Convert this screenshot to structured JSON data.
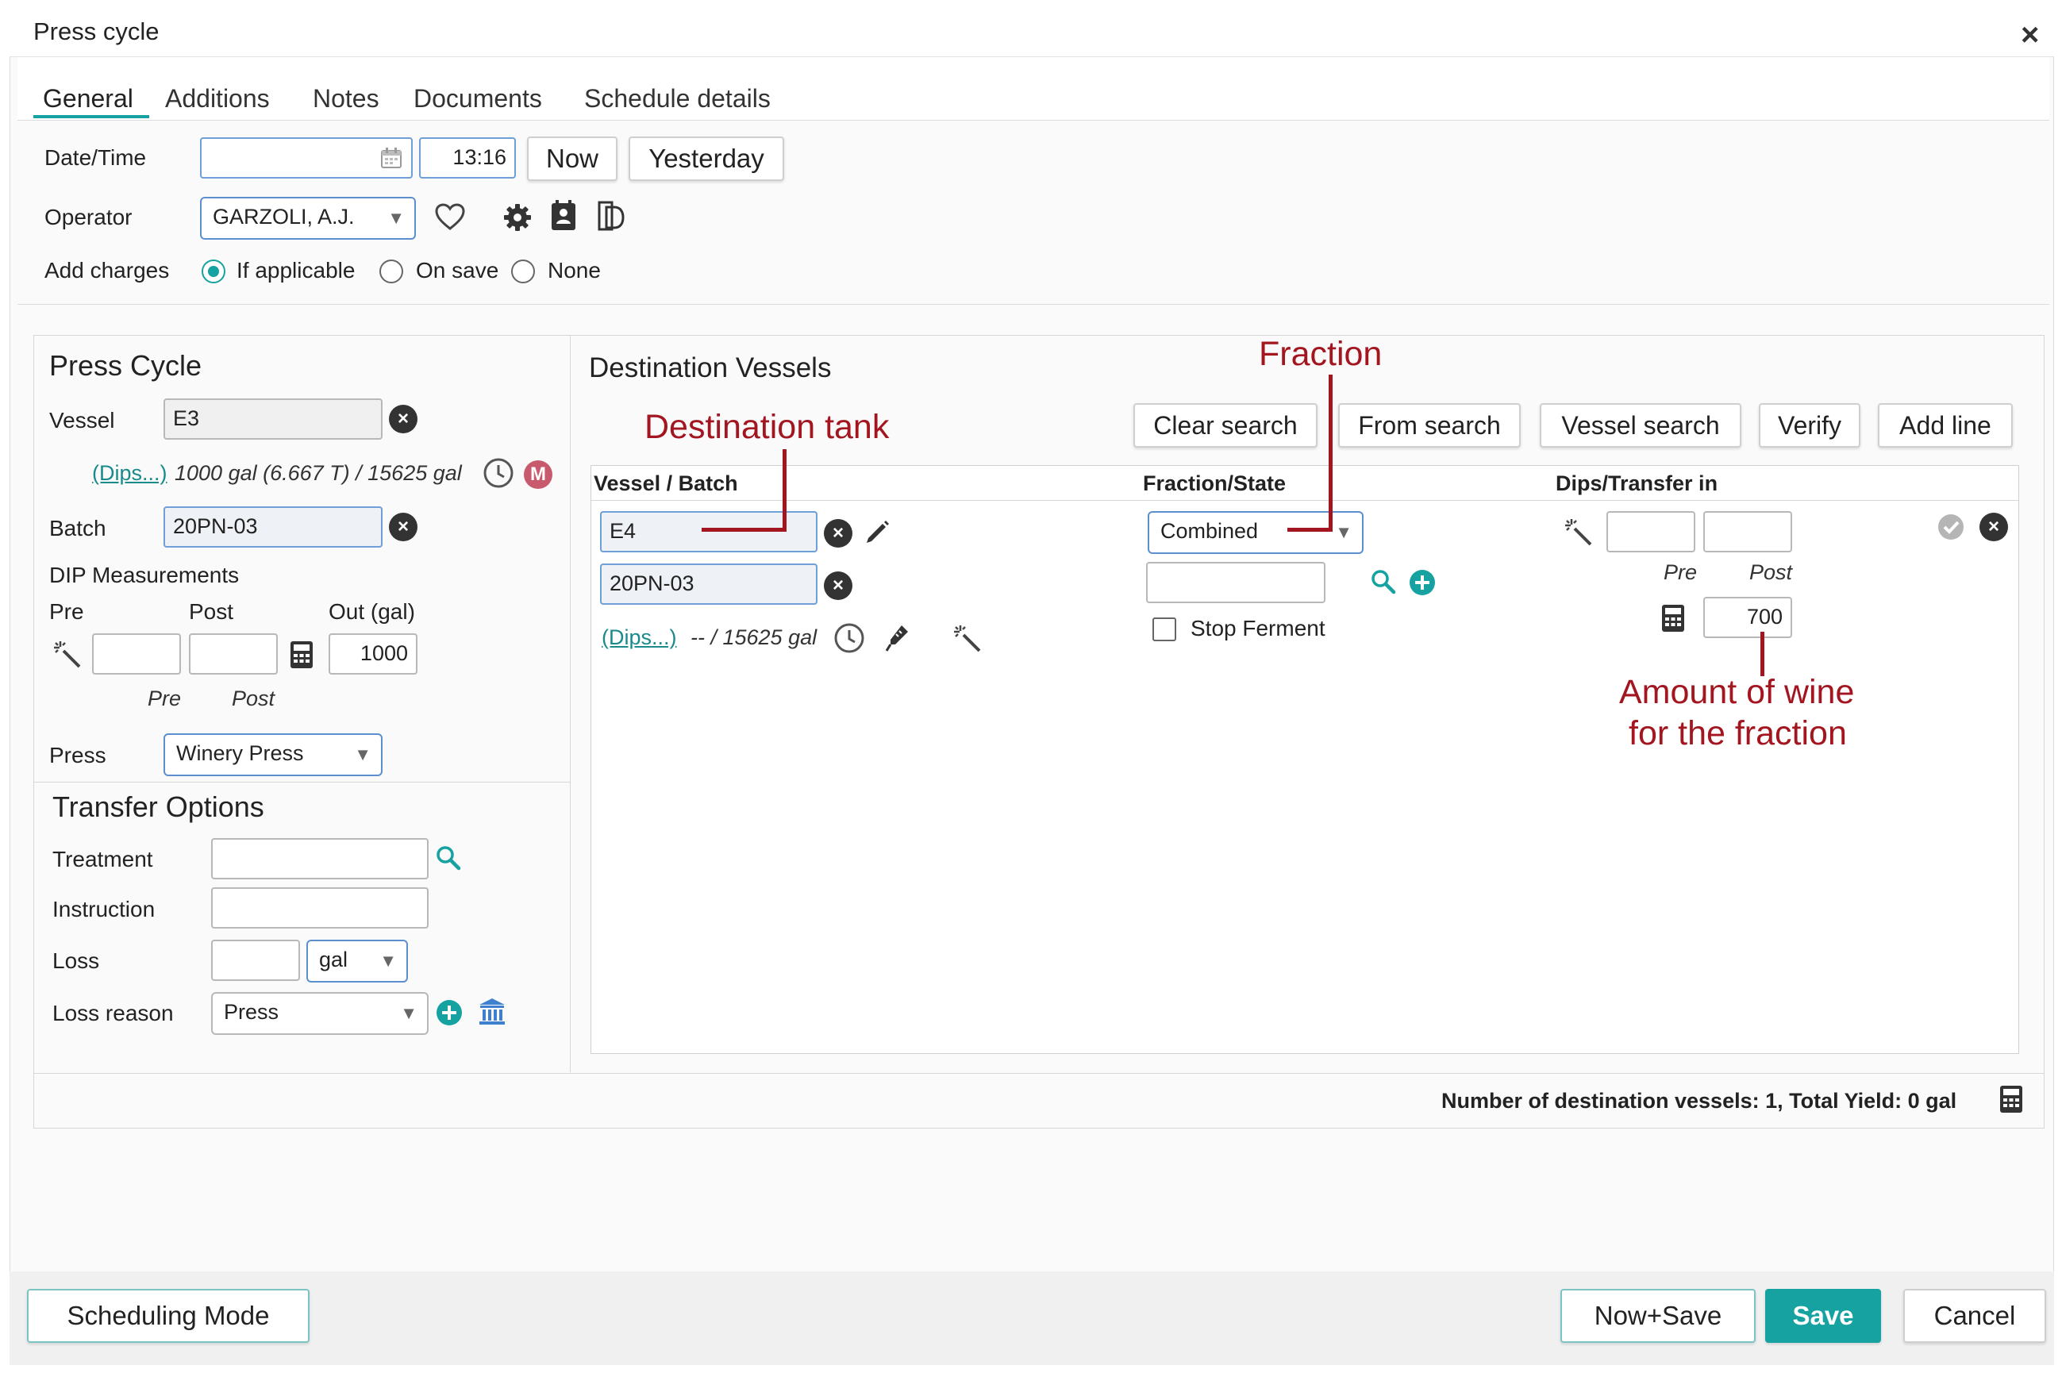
{
  "window": {
    "title": "Press cycle",
    "close_label": "×"
  },
  "tabs": [
    "General",
    "Additions",
    "Notes",
    "Documents",
    "Schedule details"
  ],
  "general": {
    "datetime_label": "Date/Time",
    "date_value": "",
    "time_value": "13:16",
    "now_label": "Now",
    "yesterday_label": "Yesterday",
    "operator_label": "Operator",
    "operator_value": "GARZOLI, A.J.",
    "add_charges_label": "Add charges",
    "charges_options": [
      "If applicable",
      "On save",
      "None"
    ],
    "charges_selected": "If applicable"
  },
  "press_cycle": {
    "title": "Press Cycle",
    "vessel_label": "Vessel",
    "vessel_value": "E3",
    "dips_link": "(Dips...)",
    "vessel_info": "1000 gal (6.667 T) / 15625 gal",
    "m_badge": "M",
    "batch_label": "Batch",
    "batch_value": "20PN-03",
    "dip_title": "DIP Measurements",
    "pre_label": "Pre",
    "post_label": "Post",
    "out_label": "Out (gal)",
    "out_value": "1000",
    "pre_sub": "Pre",
    "post_sub": "Post",
    "press_label": "Press",
    "press_value": "Winery Press"
  },
  "transfer": {
    "title": "Transfer Options",
    "treatment_label": "Treatment",
    "instruction_label": "Instruction",
    "loss_label": "Loss",
    "loss_unit": "gal",
    "loss_reason_label": "Loss reason",
    "loss_reason_value": "Press"
  },
  "destination": {
    "title": "Destination Vessels",
    "buttons": [
      "Clear search",
      "From search",
      "Vessel search",
      "Verify",
      "Add line"
    ],
    "col_vessel": "Vessel / Batch",
    "col_fraction": "Fraction/State",
    "col_dips": "Dips/Transfer in",
    "vessel_value": "E4",
    "batch_value": "20PN-03",
    "dips_link": "(Dips...)",
    "dips_info": "-- / 15625 gal",
    "fraction_value": "Combined",
    "stop_ferment_label": "Stop Ferment",
    "pre_sub": "Pre",
    "post_sub": "Post",
    "transfer_value": "700",
    "summary": "Number of destination vessels: 1, Total Yield: 0 gal"
  },
  "annotations": {
    "fraction": "Fraction",
    "destination_tank": "Destination tank",
    "amount_line1": "Amount of wine",
    "amount_line2": "for the fraction"
  },
  "footer": {
    "scheduling_mode": "Scheduling Mode",
    "now_save": "Now+Save",
    "save": "Save",
    "cancel": "Cancel"
  },
  "colors": {
    "accent": "#17a2a2",
    "annotation": "#a3151f",
    "save_bg": "#17a2a2"
  }
}
